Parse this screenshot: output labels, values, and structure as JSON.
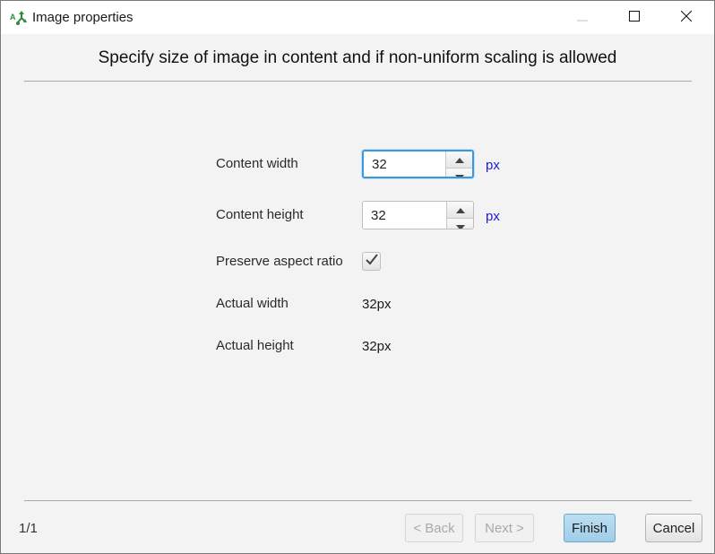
{
  "window": {
    "title": "Image properties",
    "icon": "app-logo-icon",
    "controls": {
      "minimize": "minimize-icon",
      "maximize": "maximize-icon",
      "close": "close-icon"
    }
  },
  "heading": "Specify size of image in content and if non-uniform scaling is allowed",
  "form": {
    "content_width": {
      "label": "Content width",
      "value": "32",
      "unit": "px"
    },
    "content_height": {
      "label": "Content height",
      "value": "32",
      "unit": "px"
    },
    "preserve_aspect": {
      "label": "Preserve aspect ratio",
      "checked": true
    },
    "actual_width": {
      "label": "Actual width",
      "value": "32px"
    },
    "actual_height": {
      "label": "Actual height",
      "value": "32px"
    }
  },
  "footer": {
    "page_indicator": "1/1",
    "back_label": "< Back",
    "next_label": "Next >",
    "finish_label": "Finish",
    "cancel_label": "Cancel"
  }
}
